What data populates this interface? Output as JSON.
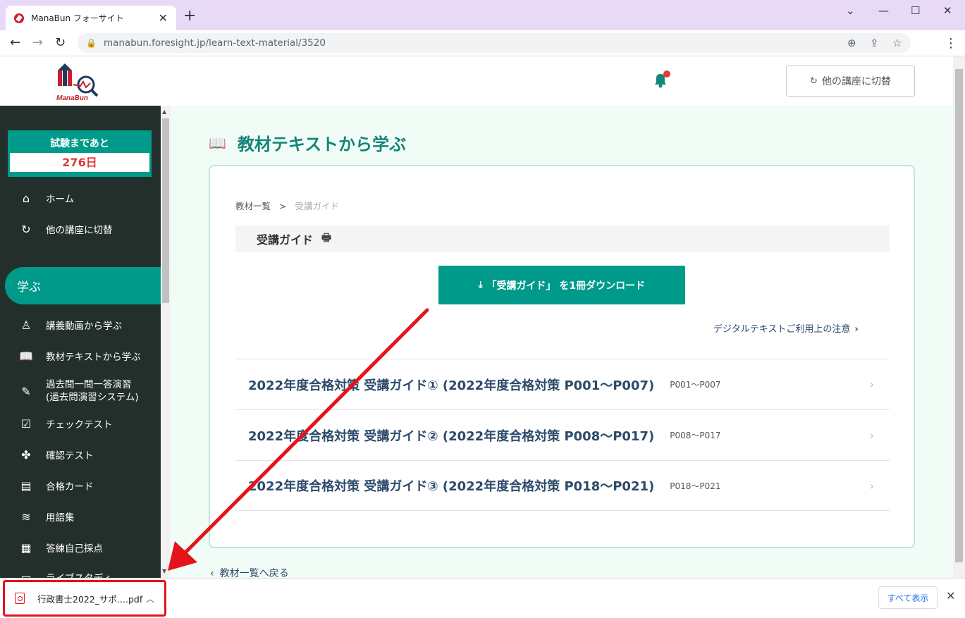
{
  "browser": {
    "tab_title": "ManaBun フォーサイト",
    "tab_close": "✕",
    "new_tab": "+",
    "url": "manabun.foresight.jp/learn-text-material/3520",
    "window_controls": {
      "chevron": "⌄",
      "minimize": "—",
      "maximize": "☐",
      "close": "✕"
    }
  },
  "header": {
    "logo_text": "ManaBun",
    "switch_button": "他の講座に切替",
    "notification_dot_color": "#e23b3b"
  },
  "sidebar": {
    "countdown_label": "試験まであと",
    "countdown_days": "276日",
    "items_top": [
      {
        "label": "ホーム",
        "icon": "home-icon"
      },
      {
        "label": "他の講座に切替",
        "icon": "refresh-icon"
      }
    ],
    "section_label": "学ぶ",
    "items": [
      {
        "label": "講義動画から学ぶ",
        "icon": "lecturer-icon"
      },
      {
        "label": "教材テキストから学ぶ",
        "icon": "book-icon"
      },
      {
        "label": "過去問一問一答演習",
        "label2": "(過去問演習システム)",
        "icon": "edit-icon"
      },
      {
        "label": "チェックテスト",
        "icon": "checklist-icon"
      },
      {
        "label": "確認テスト",
        "icon": "puzzle-icon"
      },
      {
        "label": "合格カード",
        "icon": "cards-icon"
      },
      {
        "label": "用語集",
        "icon": "layers-icon"
      },
      {
        "label": "答練自己採点",
        "icon": "grading-icon"
      },
      {
        "label": "ライブスタディ",
        "icon": "live-icon"
      }
    ]
  },
  "main": {
    "page_title": "教材テキストから学ぶ",
    "breadcrumb": {
      "parent": "教材一覧",
      "sep": ">",
      "current": "受講ガイド"
    },
    "guide_title": "受講ガイド",
    "download_button": "「受講ガイド」 を1冊ダウンロード",
    "notice_link": "デジタルテキストご利用上の注意",
    "chapters": [
      {
        "title": "2022年度合格対策 受講ガイド① (2022年度合格対策 P001～P007)",
        "pages": "P001～P007"
      },
      {
        "title": "2022年度合格対策 受講ガイド② (2022年度合格対策 P008～P017)",
        "pages": "P008～P017"
      },
      {
        "title": "2022年度合格対策 受講ガイド③ (2022年度合格対策 P018～P021)",
        "pages": "P018～P021"
      }
    ],
    "back_link": "教材一覧へ戻る"
  },
  "download_bar": {
    "file_name": "行政書士2022_サポ....pdf",
    "show_all": "すべて表示",
    "close": "✕"
  },
  "colors": {
    "accent": "#009a8a",
    "sidebar_bg": "#232f2b",
    "title_color": "#14857a",
    "annotation_red": "#e5141c"
  }
}
